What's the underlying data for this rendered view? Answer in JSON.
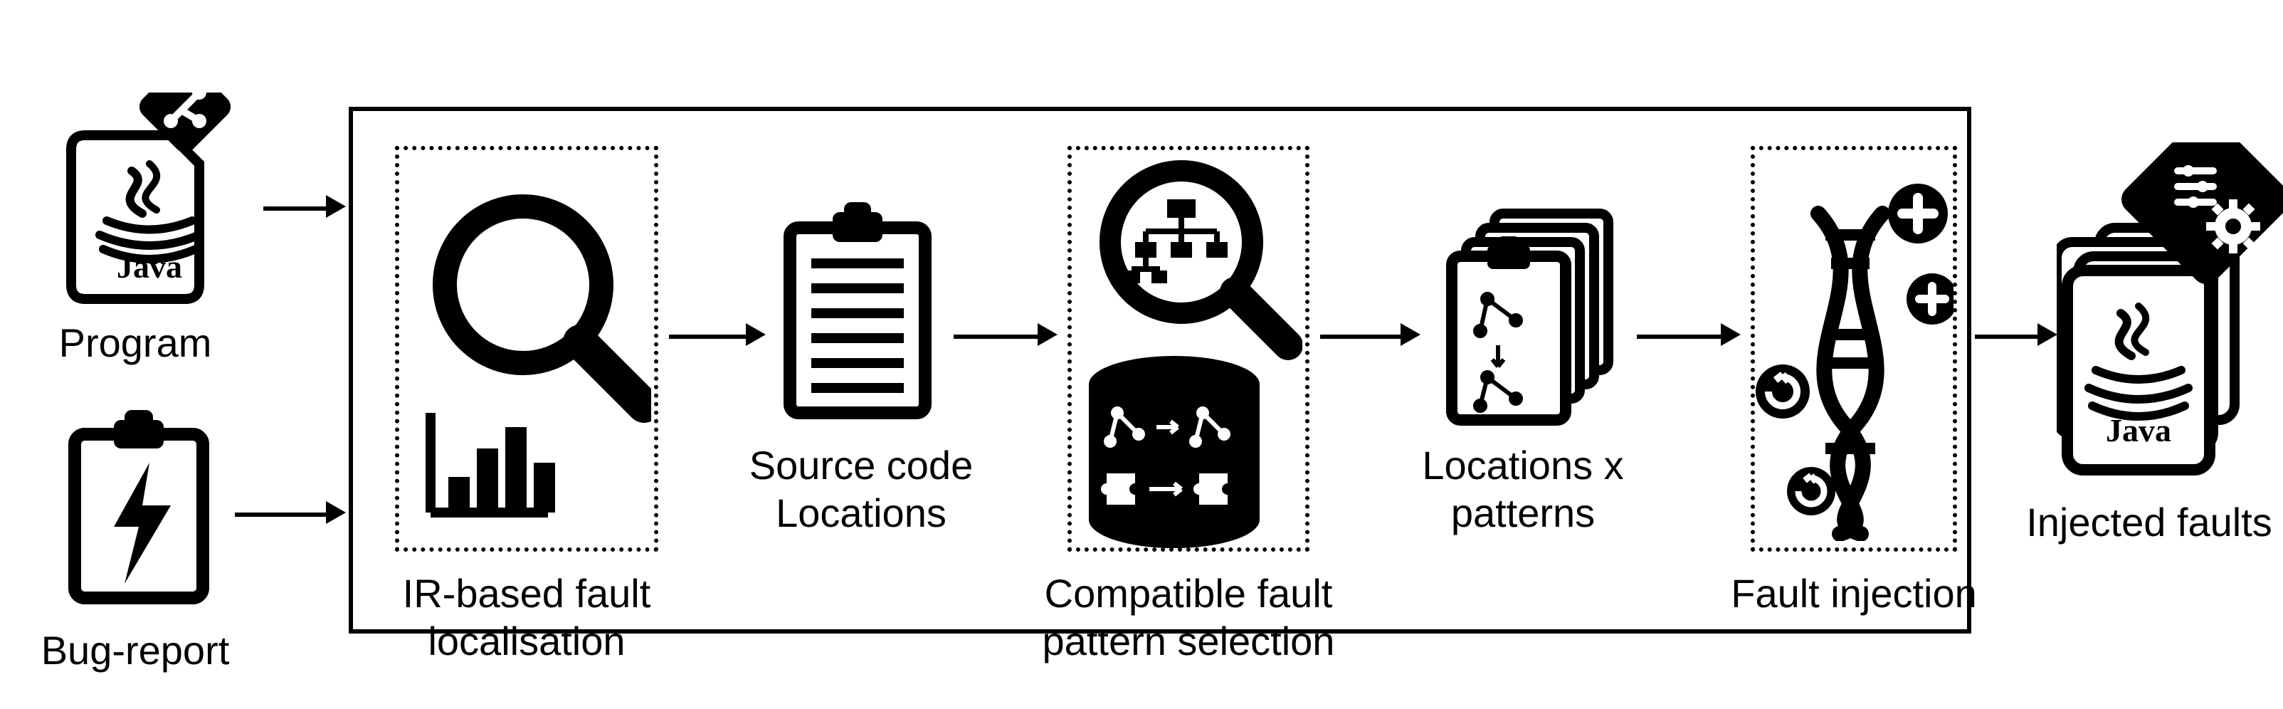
{
  "labels": {
    "program": "Program",
    "bugreport": "Bug-report",
    "ir_local": "IR-based fault\nlocalisation",
    "source_loc": "Source code\nLocations",
    "pattern_sel": "Compatible fault\npattern selection",
    "loc_patterns": "Locations x\npatterns",
    "fault_inj": "Fault injection",
    "injected": "Injected faults"
  },
  "chart_data": {
    "type": "diagram",
    "nodes": [
      {
        "id": "program",
        "label": "Program",
        "input": true
      },
      {
        "id": "bugreport",
        "label": "Bug-report",
        "input": true
      },
      {
        "id": "ir_local",
        "label": "IR-based fault localisation"
      },
      {
        "id": "source_loc",
        "label": "Source code Locations"
      },
      {
        "id": "pattern_sel",
        "label": "Compatible fault pattern selection"
      },
      {
        "id": "loc_patterns",
        "label": "Locations x patterns"
      },
      {
        "id": "fault_inj",
        "label": "Fault injection"
      },
      {
        "id": "injected",
        "label": "Injected faults",
        "output": true
      }
    ],
    "edges": [
      {
        "from": "program",
        "to": "ir_local"
      },
      {
        "from": "bugreport",
        "to": "ir_local"
      },
      {
        "from": "ir_local",
        "to": "source_loc"
      },
      {
        "from": "source_loc",
        "to": "pattern_sel"
      },
      {
        "from": "pattern_sel",
        "to": "loc_patterns"
      },
      {
        "from": "loc_patterns",
        "to": "fault_inj"
      },
      {
        "from": "fault_inj",
        "to": "injected"
      }
    ]
  }
}
